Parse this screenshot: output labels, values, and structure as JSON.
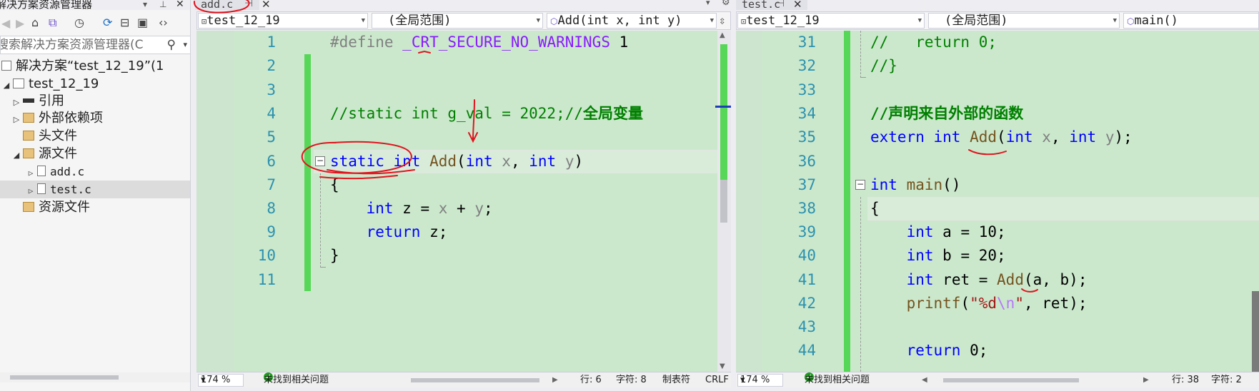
{
  "explorer": {
    "title": "解决方案资源管理器",
    "search_placeholder": "搜索解决方案资源管理器(C",
    "solution": "解决方案“test_12_19”(1",
    "project": "test_12_19",
    "nodes": {
      "references": "引用",
      "external": "外部依赖项",
      "headers": "头文件",
      "sources": "源文件",
      "add_c": "add.c",
      "test_c": "test.c",
      "resources": "资源文件"
    }
  },
  "left_editor": {
    "tab": "add.c",
    "nav": {
      "project": "test_12_19",
      "scope": "(全局范围)",
      "member": "Add(int x, int y)"
    },
    "line_numbers": [
      "1",
      "2",
      "3",
      "4",
      "5",
      "6",
      "7",
      "8",
      "9",
      "10",
      "11"
    ],
    "code": {
      "l1_pp": "#define",
      "l1_macro": "_CRT_SECURE_NO_WARNINGS",
      "l1_val": "1",
      "l4_comment": "//static int g_val = 2022;//",
      "l4_comment_cn": "全局变量",
      "l6_static": "static",
      "l6_int": "int",
      "l6_fn": "Add",
      "l6_open": "(",
      "l6_int2": "int",
      "l6_x": "x",
      "l6_comma": ", ",
      "l6_int3": "int",
      "l6_y": "y",
      "l6_close": ")",
      "l7": "{",
      "l8_int": "int",
      "l8_rest": "z = ",
      "l8_x": "x",
      "l8_plus": " + ",
      "l8_y": "y",
      "l8_semi": ";",
      "l9_return": "return",
      "l9_rest": " z;",
      "l10": "}"
    },
    "status": {
      "zoom": "174 %",
      "issues": "未找到相关问题",
      "row": "行: 6",
      "col": "字符: 8",
      "tabs": "制表符",
      "eol": "CRLF"
    }
  },
  "right_editor": {
    "tab": "test.c",
    "nav": {
      "project": "test_12_19",
      "scope": "(全局范围)",
      "member": "main()"
    },
    "line_numbers": [
      "31",
      "32",
      "33",
      "34",
      "35",
      "36",
      "37",
      "38",
      "39",
      "40",
      "41",
      "42",
      "43",
      "44"
    ],
    "code": {
      "l31": "//   return 0;",
      "l32": "//}",
      "l34": "//声明来自外部的函数",
      "l35_extern": "extern",
      "l35_int": "int",
      "l35_fn": "Add",
      "l35_open": "(",
      "l35_int2": "int",
      "l35_x": "x",
      "l35_comma": ", ",
      "l35_int3": "int",
      "l35_y": "y",
      "l35_close": ");",
      "l37_int": "int",
      "l37_fn": "main",
      "l37_parens": "()",
      "l38": "{",
      "l39_int": "int",
      "l39_rest": "a = 10;",
      "l40_int": "int",
      "l40_rest": "b = 20;",
      "l41_int": "int",
      "l41_rest": "ret = ",
      "l41_fn": "Add",
      "l41_args": "(a, b);",
      "l42_fn": "printf",
      "l42_open": "(",
      "l42_str1": "\"%d",
      "l42_esc": "\\n",
      "l42_str2": "\"",
      "l42_rest": ", ret);",
      "l44_return": "return",
      "l44_rest": " 0;"
    },
    "status": {
      "zoom": "174 %",
      "issues": "未找到相关问题",
      "row": "行: 38",
      "col": "字符: 2"
    }
  },
  "colors": {
    "code_bg": "#cbe8cc",
    "keyword": "#0000ff",
    "comment": "#008000",
    "function": "#74531f",
    "param": "#808080",
    "ink": "#e0141e"
  }
}
